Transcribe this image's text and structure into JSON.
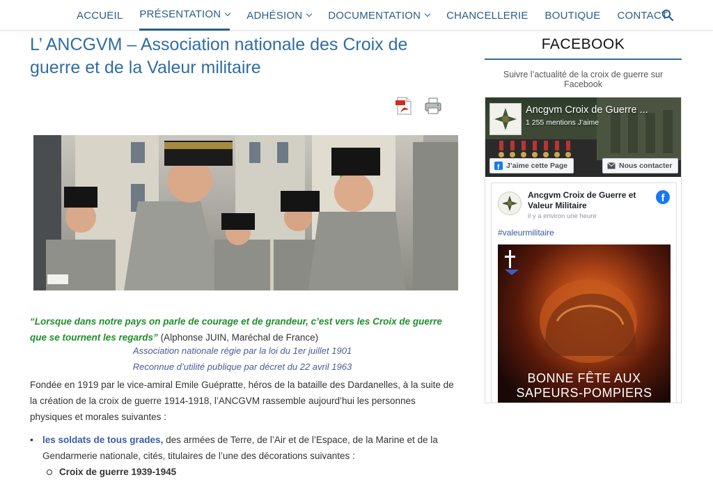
{
  "nav": {
    "items": [
      {
        "label": "ACCUEIL",
        "dropdown": false,
        "active": false
      },
      {
        "label": "PRÉSENTATION",
        "dropdown": true,
        "active": true
      },
      {
        "label": "ADHÉSION",
        "dropdown": true,
        "active": false
      },
      {
        "label": "DOCUMENTATION",
        "dropdown": true,
        "active": false
      },
      {
        "label": "CHANCELLERIE",
        "dropdown": false,
        "active": false
      },
      {
        "label": "BOUTIQUE",
        "dropdown": false,
        "active": false
      },
      {
        "label": "CONTACT",
        "dropdown": false,
        "active": false
      }
    ]
  },
  "main": {
    "title": "L’ ANCGVM – Association nationale des Croix de guerre et de la Valeur militaire",
    "quote": "“Lorsque dans notre pays on parle de courage et de grandeur, c’est vers les Croix de guerre que se tournent les regards”",
    "quote_attribution": " (Alphonse JUIN, Maréchal de France)",
    "assoc_line_1": "Association nationale régie par la loi du 1er juillet 1901",
    "assoc_line_2": "Reconnue d’utilité publique par décret du 22 avril 1963",
    "intro": "Fondée en 1919 par le vice-amiral Emile Guépratte, héros de la bataille des Dardanelles, à la suite de la création de la croix de guerre 1914-1918, l’ANCGVM rassemble aujourd’hui les personnes physiques et morales suivantes :",
    "bullet_link": "les soldats de tous grades,",
    "bullet_text": " des armées de Terre, de l’Air et de l’Espace, de la Marine et de la Gendarmerie nationale, cités, titulaires de l’une des décorations suivantes :",
    "sub_bullet": "Croix de guerre 1939-1945"
  },
  "sidebar": {
    "heading": "FACEBOOK",
    "subtitle": "Suivre l’actualité de la croix de guerre sur Facebook"
  },
  "facebook_widget": {
    "page_name": "Ancgvm Croix de Guerre ...",
    "likes": "1 255 mentions J’aime",
    "like_button": "J’aime cette Page",
    "contact_button": "Nous contacter",
    "post": {
      "author": "Ancgvm Croix de Guerre et Valeur Militaire",
      "time": "il y a environ une heure",
      "hashtag": "#valeurmilitaire",
      "image_caption_1": "BONNE FÊTE AUX",
      "image_caption_2": "SAPEURS-POMPIERS"
    }
  },
  "colors": {
    "nav_text": "#2a5d8a",
    "title": "#2f6da3",
    "quote_green": "#1f8f2b",
    "assoc_italic": "#4a5a9a",
    "link": "#3a5ca8",
    "facebook_blue": "#1877f2"
  },
  "icons": [
    "search-icon",
    "chevron-down-icon",
    "pdf-icon",
    "print-icon",
    "facebook-icon",
    "envelope-icon"
  ]
}
